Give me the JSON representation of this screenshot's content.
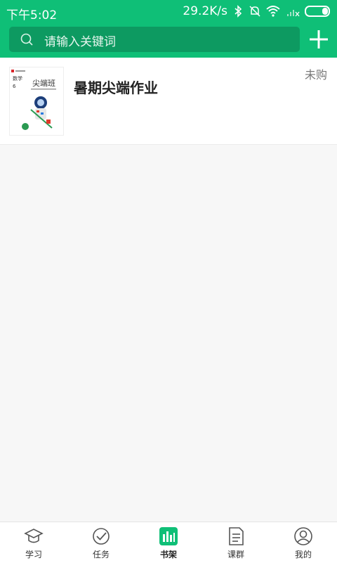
{
  "status_bar": {
    "time": "下午5:02",
    "network_speed": "29.2K/s",
    "icons": [
      "bluetooth-icon",
      "mute-icon",
      "wifi-icon",
      "signal-icon",
      "battery-icon"
    ]
  },
  "header": {
    "search_placeholder": "请输入关键词",
    "add_icon": "plus-icon",
    "accent_color": "#0fbf77"
  },
  "books": [
    {
      "title": "暑期尖端作业",
      "status": "未购",
      "cover_title": "尖端班",
      "cover_subject": "数学",
      "cover_grade": "6"
    }
  ],
  "bottom_nav": {
    "items": [
      {
        "label": "学习",
        "icon": "graduation-cap-icon"
      },
      {
        "label": "任务",
        "icon": "check-circle-icon"
      },
      {
        "label": "书架",
        "icon": "bookshelf-icon",
        "active": true
      },
      {
        "label": "课群",
        "icon": "document-icon"
      },
      {
        "label": "我的",
        "icon": "user-icon"
      }
    ]
  }
}
